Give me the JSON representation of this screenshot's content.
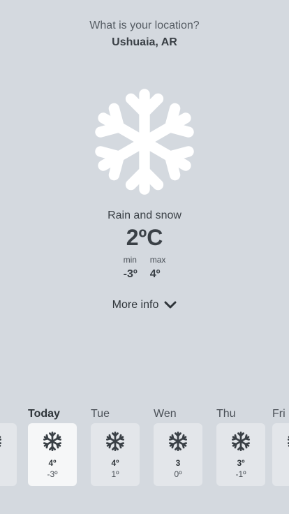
{
  "location": {
    "question": "What is your location?",
    "value": "Ushuaia, AR"
  },
  "current": {
    "icon": "snowflake-icon",
    "condition": "Rain and snow",
    "temperature": "2ºC",
    "min_label": "min",
    "min_value": "-3º",
    "max_label": "max",
    "max_value": "4º"
  },
  "more_info": {
    "label": "More info",
    "icon": "chevron-down-icon"
  },
  "forecast": [
    {
      "day": "",
      "max": "",
      "min": "",
      "icon": "snowflake-icon"
    },
    {
      "day": "Today",
      "max": "4º",
      "min": "-3º",
      "icon": "snowflake-icon",
      "active": true
    },
    {
      "day": "Tue",
      "max": "4º",
      "min": "1º",
      "icon": "snowflake-icon"
    },
    {
      "day": "Wen",
      "max": "3",
      "min": "0º",
      "icon": "snowflake-icon"
    },
    {
      "day": "Thu",
      "max": "3º",
      "min": "-1º",
      "icon": "snowflake-icon"
    },
    {
      "day": "Fri",
      "max": "",
      "min": "",
      "icon": "snowflake-icon"
    }
  ],
  "colors": {
    "background": "#d4d9df",
    "card": "#e3e6ea",
    "card_active": "#f6f7f8",
    "text": "#3a4046",
    "icon_main": "#ffffff",
    "icon_small": "#3a4046"
  }
}
